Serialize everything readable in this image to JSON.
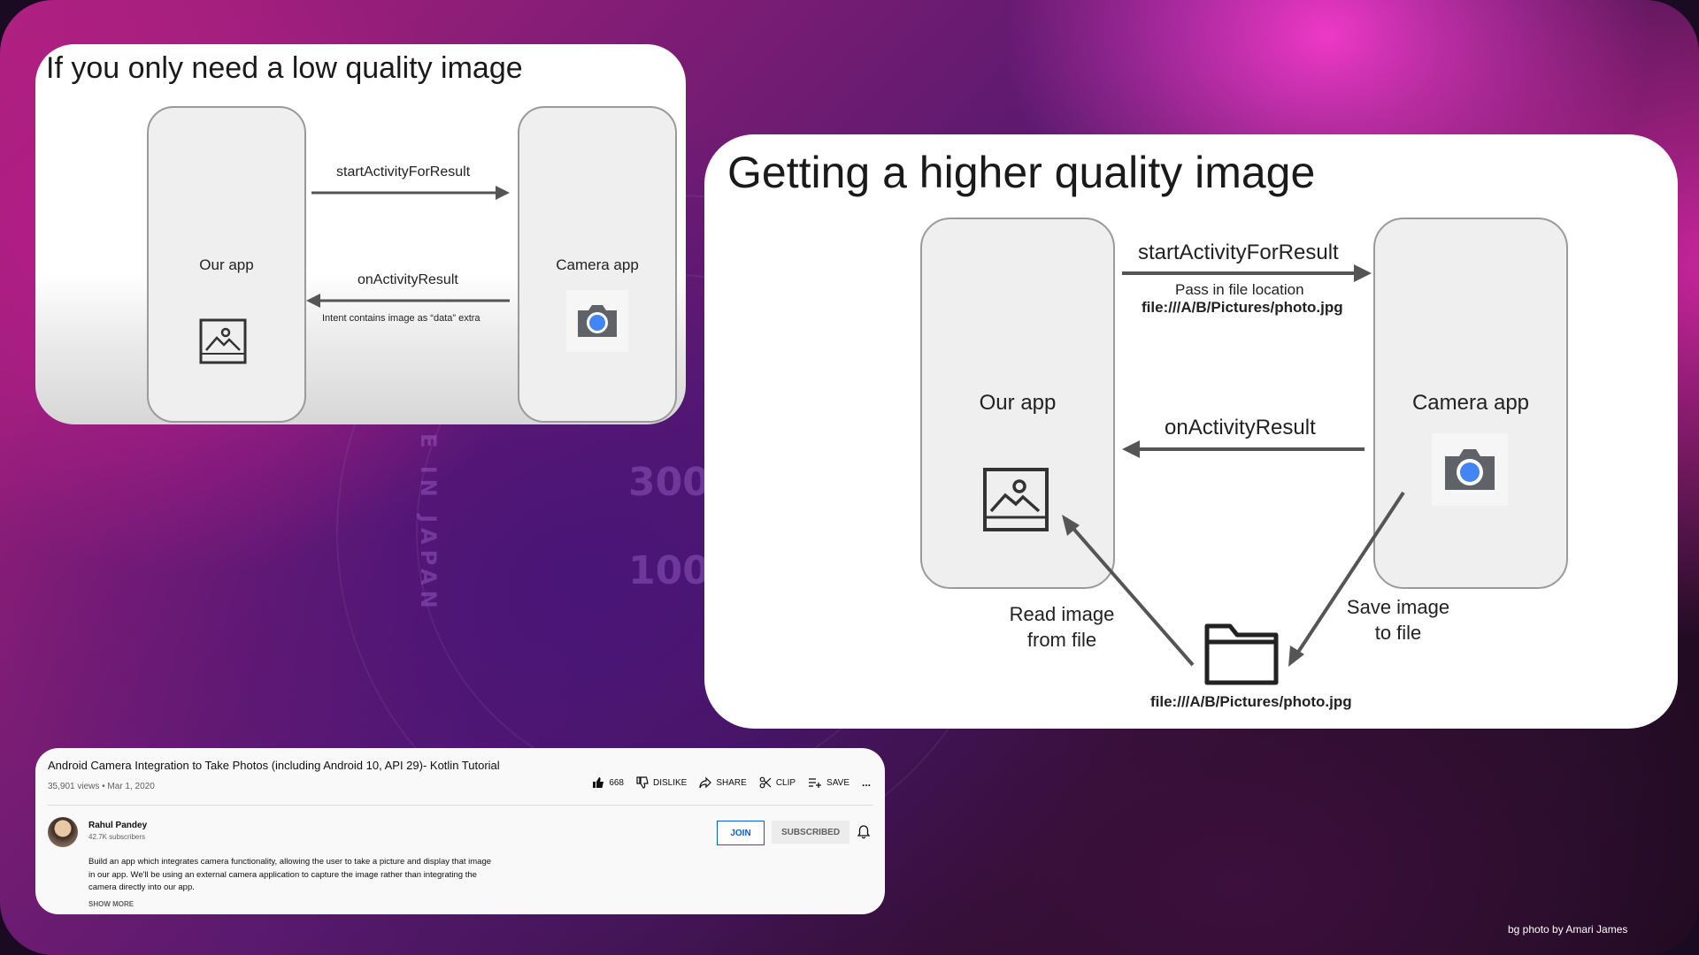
{
  "slide1": {
    "title": "If you only need a low quality image",
    "our_app": "Our app",
    "camera_app": "Camera app",
    "start_activity": "startActivityForResult",
    "on_activity_result": "onActivityResult",
    "intent_note": "Intent contains image as “data” extra"
  },
  "slide2": {
    "title": "Getting a higher quality image",
    "our_app": "Our app",
    "camera_app": "Camera app",
    "start_activity": "startActivityForResult",
    "pass_file": "Pass in file location",
    "file_path_top": "file:///A/B/Pictures/photo.jpg",
    "on_activity_result": "onActivityResult",
    "read_image_1": "Read image",
    "read_image_2": "from file",
    "save_image_1": "Save image",
    "save_image_2": "to file",
    "file_path_bottom": "file:///A/B/Pictures/photo.jpg"
  },
  "video": {
    "title": "Android Camera Integration to Take Photos (including Android 10, API 29)- Kotlin Tutorial",
    "meta": "35,901 views • Mar 1, 2020",
    "likes": "668",
    "dislike": "DISLIKE",
    "share": "SHARE",
    "clip": "CLIP",
    "save": "SAVE",
    "more_actions": "...",
    "channel": "Rahul Pandey",
    "subscribers": "42.7K subscribers",
    "join": "JOIN",
    "subscribed": "SUBSCRIBED",
    "description": "Build an app which integrates camera functionality, allowing the user to take a picture and display that image in our app. We'll be using an external camera application to capture the image rather than integrating the camera directly into our app.",
    "show_more": "SHOW MORE"
  },
  "credit": "bg photo by Amari James",
  "background_text": [
    "E IN JAPAN",
    "300",
    "100"
  ],
  "icons": [
    "image-icon",
    "camera-icon",
    "folder-icon",
    "like-icon",
    "dislike-icon",
    "share-icon",
    "clip-icon",
    "save-icon",
    "bell-icon"
  ],
  "colors": {
    "accent_blue": "#065fd4",
    "camera_blue": "#4285f4"
  }
}
